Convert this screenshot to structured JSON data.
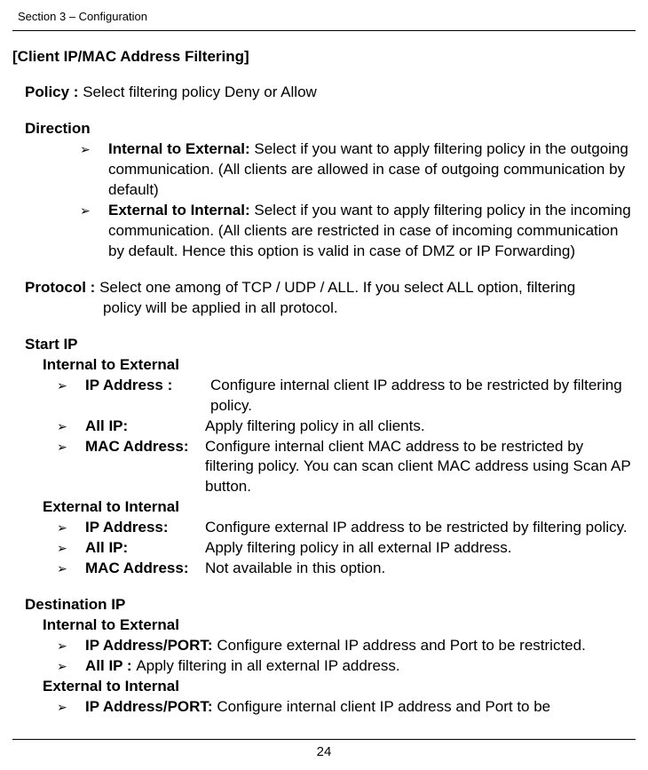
{
  "header": "Section 3 – Configuration",
  "title": "[Client IP/MAC Address Filtering]",
  "policy": {
    "label": "Policy : ",
    "text": "Select filtering policy Deny or Allow"
  },
  "direction": {
    "label": "Direction",
    "items": [
      {
        "term": "Internal to External: ",
        "desc": "Select if you want to apply filtering policy in the outgoing communication. (All clients are allowed in case of outgoing communication by default)"
      },
      {
        "term": "External to Internal: ",
        "desc": "Select if you want to apply filtering policy in the incoming communication. (All clients are restricted in case of incoming communication by default. Hence this option is valid in case of DMZ or IP Forwarding)"
      }
    ]
  },
  "protocol": {
    "label": "Protocol : ",
    "line1": "Select one among of TCP / UDP / ALL. If you select ALL option, filtering",
    "line2": "policy will be applied in all protocol."
  },
  "startip": {
    "label": "Start IP",
    "i2e": {
      "label": "Internal to External",
      "items": [
        {
          "term": "IP Address :",
          "desc": "Configure internal client IP address to be restricted by  filtering policy."
        },
        {
          "term": "All IP:",
          "desc": "Apply filtering policy in all clients."
        },
        {
          "term": "MAC Address:",
          "desc": "Configure internal client MAC address to be restricted by filtering policy. You can scan client MAC address using Scan AP button."
        }
      ]
    },
    "e2i": {
      "label": "External to Internal",
      "items": [
        {
          "term": "IP Address:",
          "desc": "Configure external IP address to be restricted by filtering policy."
        },
        {
          "term": "All IP:",
          "desc": "Apply filtering policy in all external IP address."
        },
        {
          "term": "MAC Address:",
          "desc": "Not available in this option."
        }
      ]
    }
  },
  "destip": {
    "label": "Destination IP",
    "i2e": {
      "label": "Internal to External",
      "items": [
        {
          "term": "IP Address/PORT: ",
          "desc": "Configure external IP address and Port to be restricted."
        },
        {
          "term": "All IP : ",
          "desc": "Apply filtering in all external IP address."
        }
      ]
    },
    "e2i": {
      "label": "External to Internal",
      "items": [
        {
          "term": "IP Address/PORT: ",
          "desc": "Configure internal client IP address and Port to be"
        }
      ]
    }
  },
  "page_number": "24"
}
